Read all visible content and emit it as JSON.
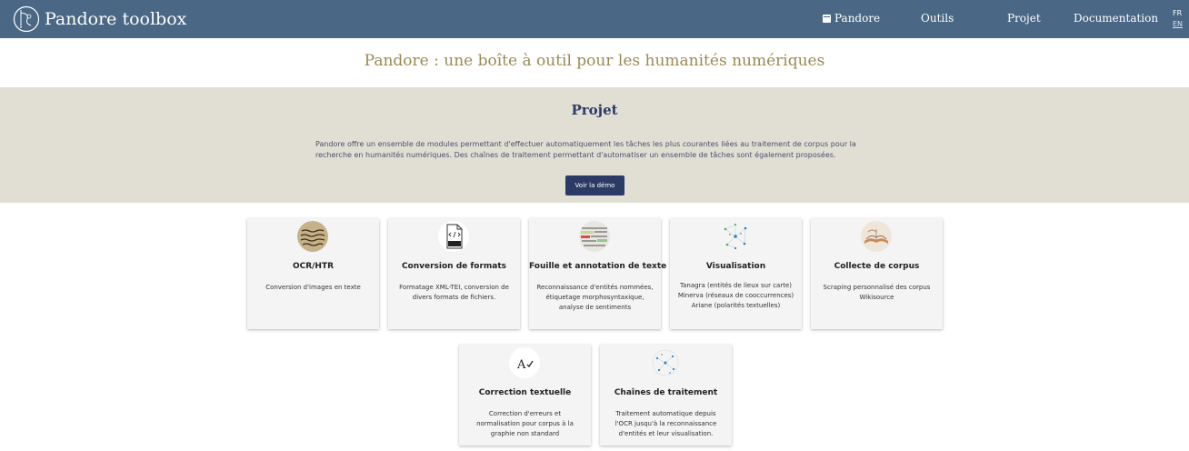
{
  "brand": {
    "title": "Pandore toolbox",
    "logo_icon": "pandore-logo-icon"
  },
  "nav": {
    "items": [
      {
        "label": "Pandore",
        "icon": "calendar-icon"
      },
      {
        "label": "Outils"
      },
      {
        "label": "Projet"
      },
      {
        "label": "Documentation"
      }
    ],
    "languages": [
      "FR",
      "EN"
    ],
    "active_language": "FR"
  },
  "page": {
    "title": "Pandore : une boîte à outil pour les humanités numériques"
  },
  "project": {
    "title": "Projet",
    "description": "Pandore offre un ensemble de modules permettant d'effectuer automatiquement les tâches les plus courantes liées au traitement de corpus pour la recherche en humanités numériques. Des chaînes de traitement permettant d'automatiser un ensemble de tâches sont également proposées.",
    "demo_button": "Voir la démo"
  },
  "cards": [
    {
      "title": "OCR/HTR",
      "icon": "manuscript-icon",
      "description": [
        "Conversion d'images en texte"
      ]
    },
    {
      "title": "Conversion de formats",
      "icon": "xml-file-icon",
      "description": [
        "Formatage XML-TEI, conversion de divers formats de fichiers."
      ]
    },
    {
      "title": "Fouille et annotation de texte",
      "icon": "annotated-text-icon",
      "description": [
        "Reconnaissance d'entités nommées, étiquetage morphosyntaxique, analyse de sentiments"
      ]
    },
    {
      "title": "Visualisation",
      "icon": "network-graph-icon",
      "description": [
        "Tanagra (entités de lieux sur carte)",
        "Minerva (réseaux de cooccurrences)",
        "Ariane (polarités textuelles)"
      ]
    },
    {
      "title": "Collecte de corpus",
      "icon": "open-book-icon",
      "description": [
        "Scraping personnalisé des corpus Wikisource"
      ]
    },
    {
      "title": "Correction textuelle",
      "icon": "spellcheck-icon",
      "description": [
        "Correction d'erreurs et normalisation pour corpus à la graphie non standard"
      ]
    },
    {
      "title": "Chaînes de traitement",
      "icon": "pipeline-graph-icon",
      "description": [
        "Traitement automatique depuis l'OCR jusqu'à la reconnaissance d'entités et leur visualisation."
      ]
    }
  ],
  "colors": {
    "navbar": "#4a6785",
    "band": "#e1dfd4",
    "accent": "#2c3a66",
    "title": "#9a8a52"
  }
}
